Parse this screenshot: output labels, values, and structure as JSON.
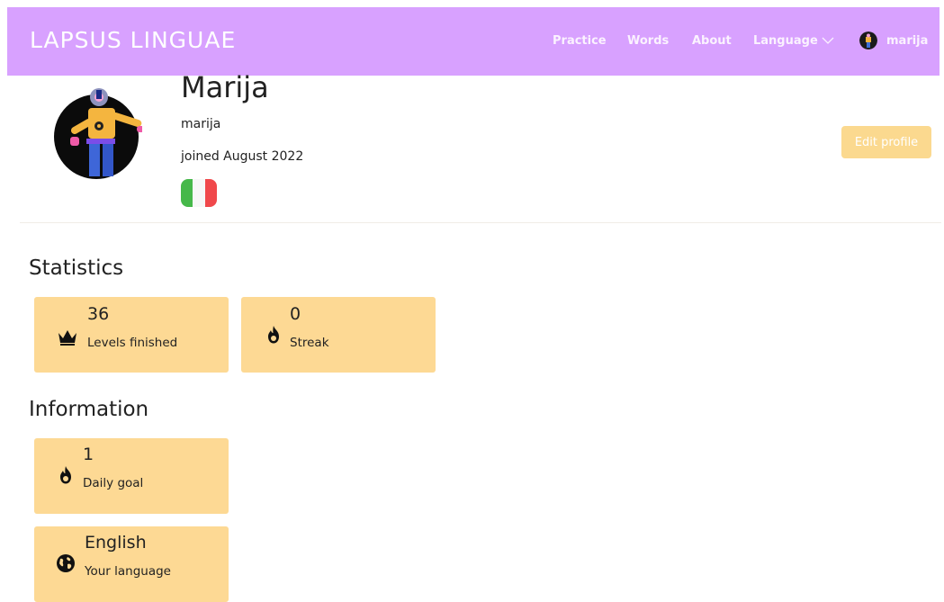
{
  "navbar": {
    "brand": "LAPSUS LINGUAE",
    "links": {
      "practice": "Practice",
      "words": "Words",
      "about": "About",
      "language": "Language"
    },
    "user": "marija",
    "background": "#d8a1ff"
  },
  "profile": {
    "name": "Marija",
    "username": "marija",
    "joined": "joined August 2022",
    "flag": "italy-flag",
    "edit_label": "Edit profile"
  },
  "statistics": {
    "title": "Statistics",
    "cards": [
      {
        "value": "36",
        "label": "Levels finished",
        "icon": "crown-icon"
      },
      {
        "value": "0",
        "label": "Streak",
        "icon": "fire-icon"
      }
    ]
  },
  "information": {
    "title": "Information",
    "cards": [
      {
        "value": "1",
        "label": "Daily goal",
        "icon": "fire-icon"
      },
      {
        "value": "English",
        "label": "Your language",
        "icon": "globe-icon"
      }
    ]
  },
  "colors": {
    "accent": "#d8a1ff",
    "card": "#fdd994",
    "button": "#fbd98f"
  }
}
